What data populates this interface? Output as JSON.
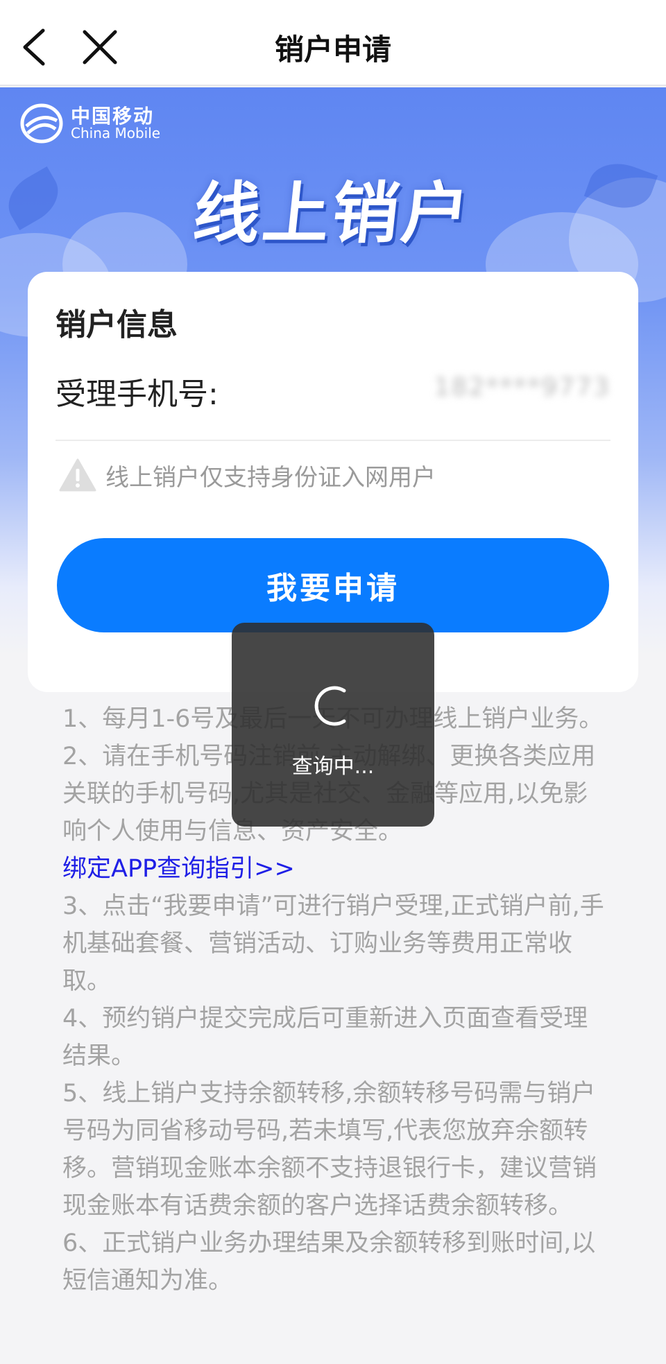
{
  "header": {
    "title": "销户申请"
  },
  "brand": {
    "name_cn": "中国移动",
    "name_en": "China Mobile"
  },
  "hero": {
    "title": "线上销户"
  },
  "card": {
    "section_title": "销户信息",
    "phone_label": "受理手机号:",
    "phone_value": "182****9773",
    "notice": "线上销户仅支持身份证入网用户",
    "apply_button": "我要申请"
  },
  "notes": {
    "n1": "1、每月1-6号及最后一天不可办理线上销户业务。",
    "n2": "2、请在手机号码注销前,主动解绑、更换各类应用关联的手机号码,尤其是社交、金融等应用,以免影响个人使用与信息、资产安全。",
    "link": "绑定APP查询指引>>",
    "n3": "3、点击“我要申请”可进行销户受理,正式销户前,手机基础套餐、营销活动、订购业务等费用正常收取。",
    "n4": "4、预约销户提交完成后可重新进入页面查看受理结果。",
    "n5": "5、线上销户支持余额转移,余额转移号码需与销户号码为同省移动号码,若未填写,代表您放弃余额转移。营销现金账本余额不支持退银行卡，建议营销现金账本有话费余额的客户选择话费余额转移。",
    "n6": "6、正式销户业务办理结果及余额转移到账时间,以短信通知为准。"
  },
  "loading": {
    "text": "查询中..."
  },
  "colors": {
    "primary": "#0a7cff",
    "hero_top": "#5f86f2",
    "link": "#1f1fe6"
  },
  "icons": {
    "back": "chevron-left-icon",
    "close": "close-icon",
    "logo": "china-mobile-logo-icon",
    "warning": "warning-triangle-icon",
    "spinner": "spinner-icon"
  }
}
